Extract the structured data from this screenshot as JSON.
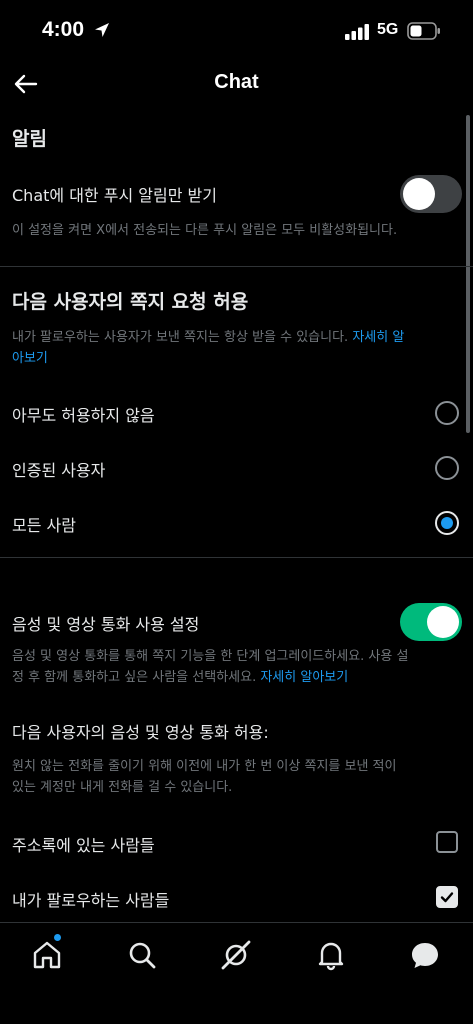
{
  "status_bar": {
    "time": "4:00",
    "network": "5G"
  },
  "nav": {
    "title": "Chat"
  },
  "notifications": {
    "heading": "알림",
    "push_only_label": "Chat에 대한 푸시 알림만 받기",
    "push_only_on": false,
    "push_only_desc": "이 설정을 켜면 X에서 전송되는 다른 푸시 알림은 모두 비활성화됩니다."
  },
  "dm_requests": {
    "heading": "다음 사용자의 쪽지 요청 허용",
    "desc": "내가 팔로우하는 사용자가 보낸 쪽지는 항상 받을 수 있습니다. ",
    "learn_more_line1": "자세히 알",
    "learn_more_line2": "아보기",
    "options": [
      {
        "label": "아무도 허용하지 않음",
        "selected": false
      },
      {
        "label": "인증된 사용자",
        "selected": false
      },
      {
        "label": "모든 사람",
        "selected": true
      }
    ]
  },
  "calls": {
    "toggle_label": "음성 및 영상 통화 사용 설정",
    "toggle_on": true,
    "desc_line1": "음성 및 영상 통화를 통해 쪽지 기능을 한 단계 업그레이드하세요. 사용 설",
    "desc_line2": "정 후 함께 통화하고 싶은 사람을 선택하세요. ",
    "learn_more": "자세히 알아보기",
    "allow_heading": "다음 사용자의 음성 및 영상 통화 허용:",
    "allow_desc_line1": "원치 않는 전화를 줄이기 위해 이전에 내가 한 번 이상 쪽지를 보낸 적이",
    "allow_desc_line2": "있는 계정만 내게 전화를 걸 수 있습니다.",
    "options": [
      {
        "label": "주소록에 있는 사람들",
        "checked": false
      },
      {
        "label": "내가 팔로우하는 사람들",
        "checked": true
      }
    ]
  },
  "tabbar": {
    "icons": [
      "home-icon",
      "search-icon",
      "grok-icon",
      "bell-icon",
      "messages-icon"
    ],
    "home_has_badge": true
  },
  "colors": {
    "accent": "#1d9bf0",
    "toggle_on": "#00ba7c",
    "background": "#000000"
  }
}
